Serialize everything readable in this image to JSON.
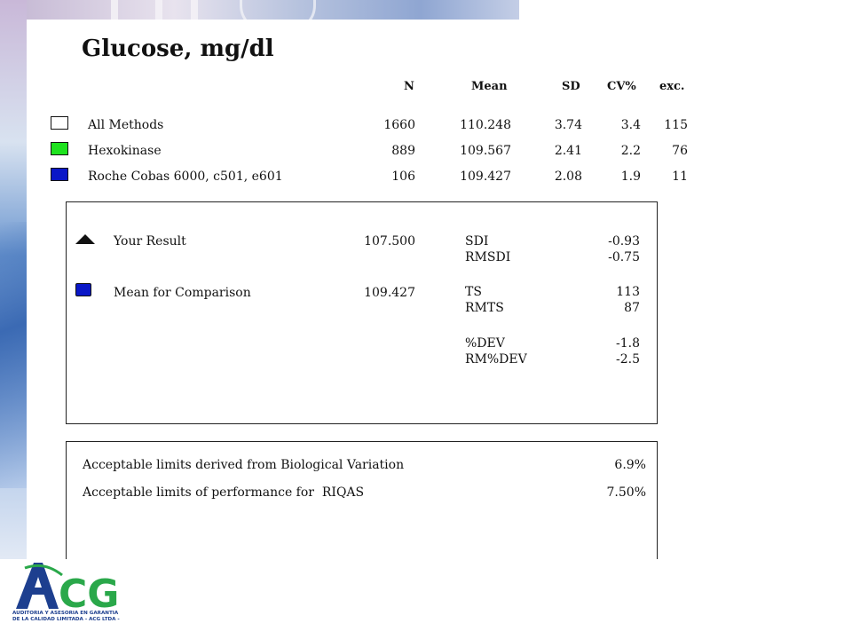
{
  "report": {
    "title": "Glucose, mg/dl",
    "columns": [
      "N",
      "Mean",
      "SD",
      "CV%",
      "exc."
    ],
    "methods": [
      {
        "label": "All Methods",
        "swatch_color": "#ffffff",
        "n": "1660",
        "mean": "110.248",
        "sd": "3.74",
        "cv": "3.4",
        "exc": "115"
      },
      {
        "label": "Hexokinase",
        "swatch_color": "#1ee21e",
        "n": "889",
        "mean": "109.567",
        "sd": "2.41",
        "cv": "2.2",
        "exc": "76"
      },
      {
        "label": "Roche Cobas 6000, c501, e601",
        "swatch_color": "#0a17c7",
        "n": "106",
        "mean": "109.427",
        "sd": "2.08",
        "cv": "1.9",
        "exc": "11"
      }
    ]
  },
  "result_box": {
    "your_result": {
      "icon": "triangle-marker",
      "label": "Your Result",
      "value": "107.500"
    },
    "comparison": {
      "icon": "blue-square-marker",
      "color": "#0a17c7",
      "label": "Mean for Comparison",
      "value": "109.427"
    },
    "stats": [
      {
        "label": "SDI",
        "value": "-0.93"
      },
      {
        "label": "RMSDI",
        "value": "-0.75"
      },
      {
        "label": "TS",
        "value": "113"
      },
      {
        "label": "RMTS",
        "value": "87"
      },
      {
        "label": "%DEV",
        "value": "-1.8"
      },
      {
        "label": "RM%DEV",
        "value": "-2.5"
      }
    ]
  },
  "limits_box": {
    "biological_label": "Acceptable limits derived from Biological Variation",
    "biological_value": "6.9%",
    "riqas_label": "Acceptable limits of performance for  RIQAS",
    "riqas_value": "7.50%"
  },
  "logo": {
    "text": "ACG",
    "tagline_1": "AUDITORIA Y ASESORIA EN GARANTIA",
    "tagline_2": "DE LA CALIDAD LIMITADA - ACG LTDA -",
    "color_blue": "#1d3f8f",
    "color_green": "#2aa84a"
  }
}
